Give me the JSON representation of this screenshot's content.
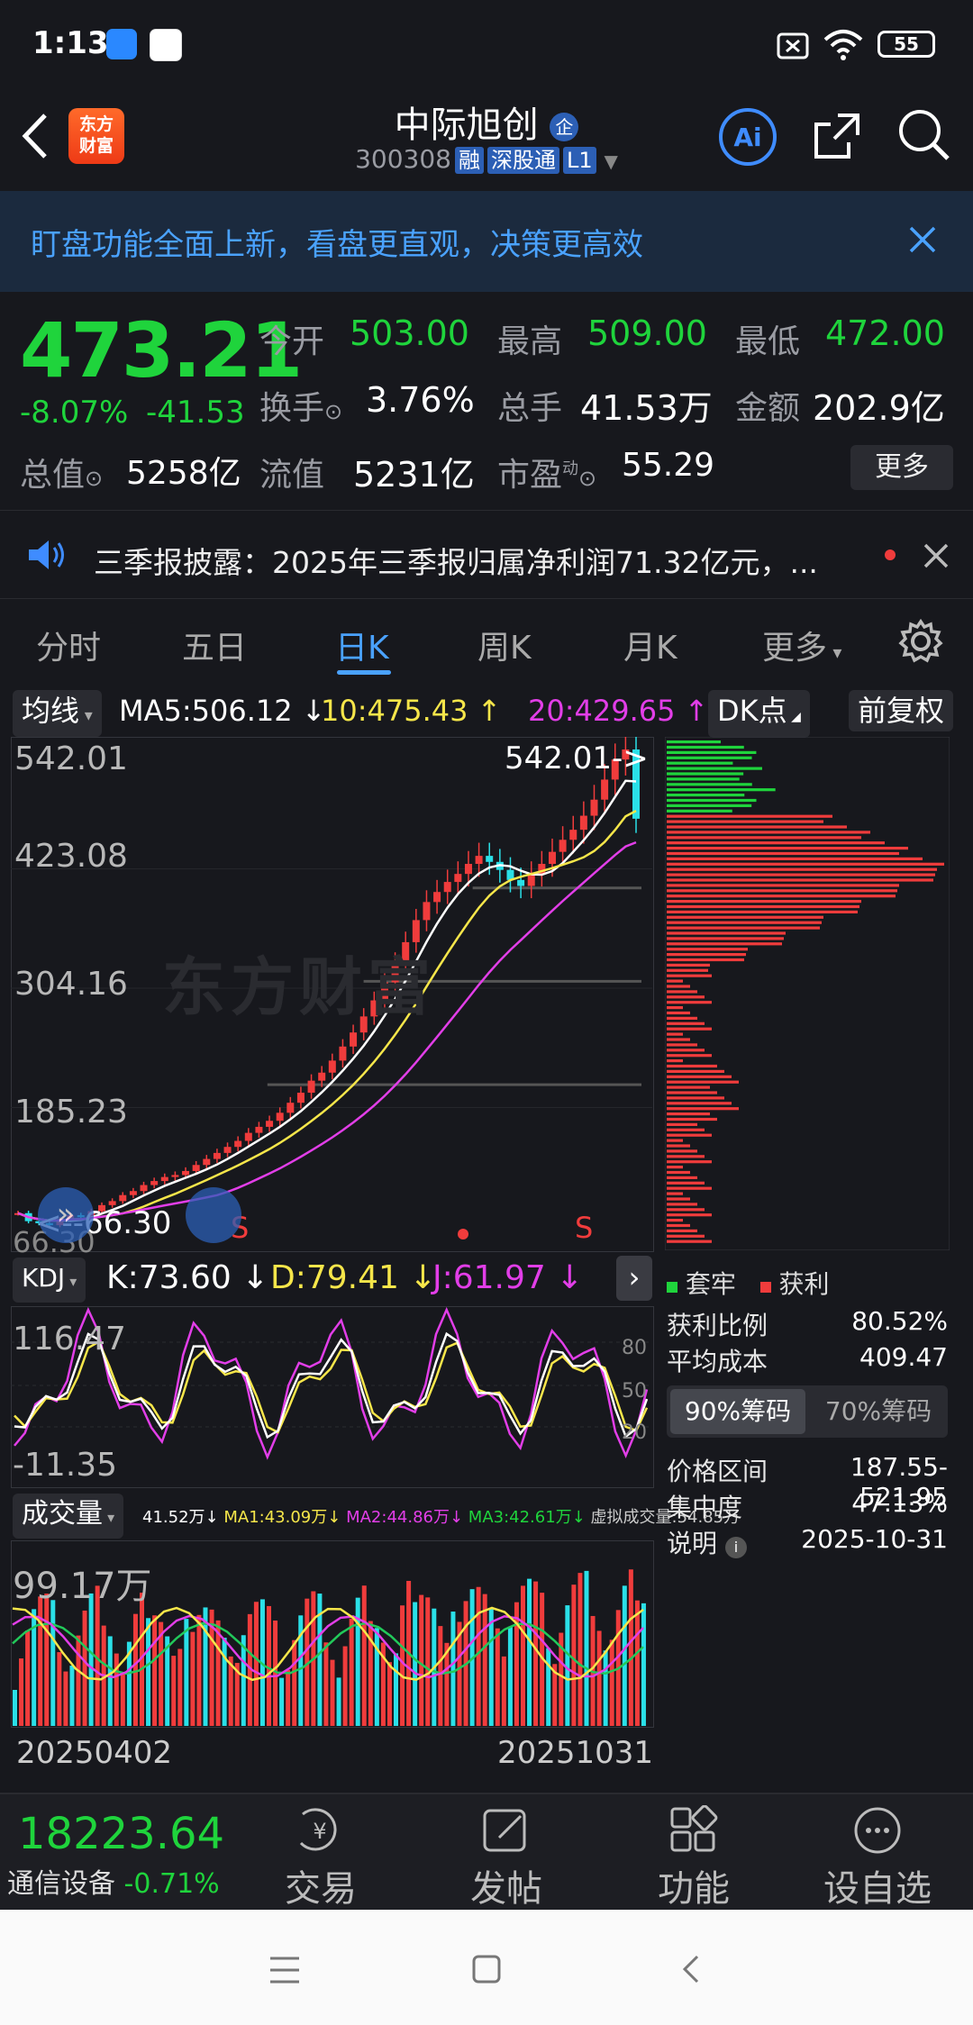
{
  "status_bar": {
    "time": "1:13",
    "battery": "55"
  },
  "header": {
    "logo_line1": "东方",
    "logo_line2": "财富",
    "stock_name": "中际旭创",
    "badge": "企",
    "stock_code": "300308",
    "tag1": "融",
    "tag2": "深股通",
    "tag3": "L1"
  },
  "banner": {
    "text": "盯盘功能全面上新，看盘更直观，决策更高效"
  },
  "quote": {
    "price": "473.21",
    "change_pct": "-8.07%",
    "change_amt": "-41.53",
    "open_label": "今开",
    "open": "503.00",
    "high_label": "最高",
    "high": "509.00",
    "low_label": "最低",
    "low": "472.00",
    "turnover_label": "换手",
    "turnover": "3.76%",
    "volume_label": "总手",
    "volume": "41.53万",
    "amount_label": "金额",
    "amount": "202.9亿",
    "mktcap_label": "总值",
    "mktcap": "5258亿",
    "float_label": "流值",
    "float": "5231亿",
    "pe_label": "市盈",
    "pe_sup": "动",
    "pe": "55.29",
    "more": "更多"
  },
  "news": {
    "text": "三季报披露：2025年三季报归属净利润71.32亿元，..."
  },
  "tabs": [
    "分时",
    "五日",
    "日K",
    "周K",
    "月K",
    "更多"
  ],
  "active_tab": 2,
  "ma_bar": {
    "label": "均线",
    "ma5": "MA5:506.12 ↓",
    "ma10": "10:475.43 ↑",
    "ma20": "20:429.65 ↑",
    "dk": "DK点",
    "adj": "前复权"
  },
  "kline": {
    "y_labels": [
      "542.01",
      "423.08",
      "304.16",
      "185.23"
    ],
    "high_marker": "542.01->",
    "low_marker": "<--66.30",
    "bottom_cut": "66.30",
    "s_marker": "S",
    "watermark": "东方财富"
  },
  "kdj": {
    "label": "KDJ",
    "k": "K:73.60 ↓",
    "d": "D:79.41 ↓",
    "j": "J:61.97 ↓",
    "top": "116.47",
    "bottom": "-11.35",
    "l80": "80",
    "l50": "50",
    "l20": "20"
  },
  "volume_panel": {
    "label": "成交量",
    "v": "41.52万↓",
    "ma1": "MA1:43.09万↓",
    "ma2": "MA2:44.86万↓",
    "ma3": "MA3:42.61万↓",
    "virtual": "虚拟成交量:54.85万",
    "top": "99.17万",
    "date_start": "20250402",
    "date_end": "20251031"
  },
  "chips_panel": {
    "legend_trapped": "套牢",
    "legend_profit": "获利",
    "rows": [
      {
        "label": "获利比例",
        "value": "80.52%"
      },
      {
        "label": "平均成本",
        "value": "409.47"
      }
    ],
    "tab90": "90%筹码",
    "tab70": "70%筹码",
    "rows2": [
      {
        "label": "价格区间",
        "value": "187.55-521.95"
      },
      {
        "label": "集中度",
        "value": "47.13%"
      },
      {
        "label": "说明",
        "value": "2025-10-31"
      }
    ]
  },
  "bottom_nav": {
    "index_value": "18223.64",
    "index_name": "通信设备",
    "index_change": "-0.71%",
    "items": [
      "交易",
      "发帖",
      "功能",
      "设自选"
    ]
  },
  "chart_data": {
    "type": "candlestick",
    "y_labels": [
      542.01,
      423.08,
      304.16,
      185.23
    ],
    "ylim": [
      66.3,
      542.01
    ],
    "x": [
      "20250402",
      "20251031"
    ],
    "close": [
      80,
      72,
      70,
      68,
      74,
      78,
      76,
      82,
      88,
      92,
      98,
      102,
      108,
      112,
      116,
      118,
      122,
      128,
      134,
      140,
      146,
      152,
      160,
      166,
      172,
      180,
      190,
      200,
      212,
      220,
      232,
      246,
      260,
      276,
      292,
      310,
      330,
      350,
      372,
      390,
      400,
      410,
      418,
      428,
      436,
      430,
      422,
      412,
      406,
      418,
      428,
      440,
      452,
      462,
      476,
      492,
      512,
      532,
      542,
      473
    ],
    "colors": {
      "up": "#f03c3c",
      "down": "#2ae0e8",
      "ma5": "#ffffff",
      "ma10": "#f6e64a",
      "ma20": "#e23ee8"
    }
  }
}
